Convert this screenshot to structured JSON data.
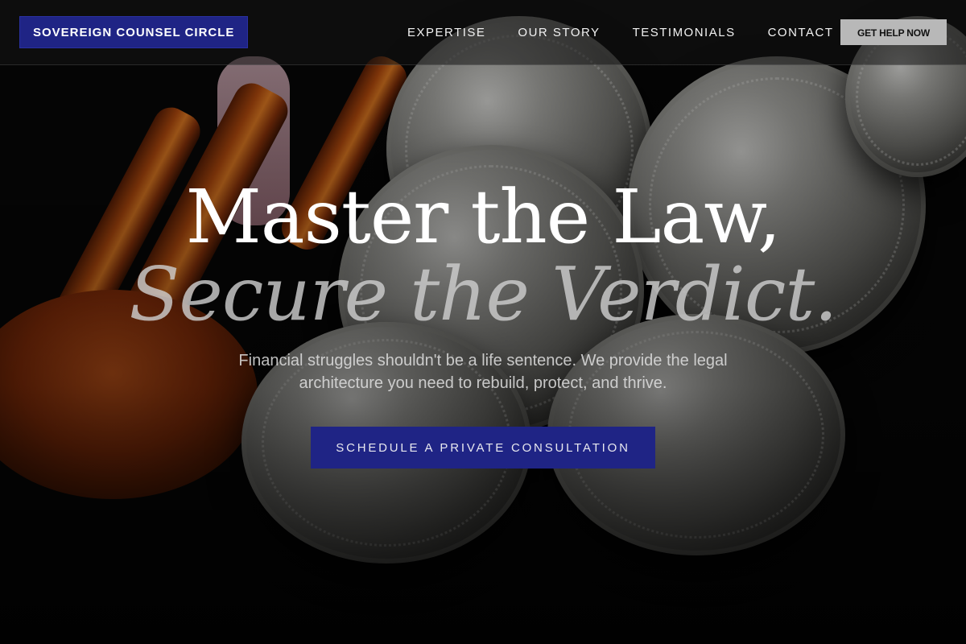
{
  "nav": {
    "brand": "SOVEREIGN COUNSEL CIRCLE",
    "links": [
      {
        "label": "EXPERTISE"
      },
      {
        "label": "OUR STORY"
      },
      {
        "label": "TESTIMONIALS"
      },
      {
        "label": "CONTACT"
      }
    ],
    "cta_label": "GET HELP NOW"
  },
  "hero": {
    "headline_line1": "Master the Law,",
    "headline_line2": "Secure the Verdict.",
    "subtext": "Financial struggles shouldn't be a life sentence. We provide the legal architecture you need to rebuild, protect, and thrive.",
    "cta_label": "SCHEDULE A PRIVATE CONSULTATION"
  },
  "colors": {
    "accent": "#1f2485",
    "nav_cta_bg": "#b8b8b8",
    "background": "#070707"
  },
  "icons": {
    "hero_image": "gavel-coins-hourglass-photo"
  }
}
